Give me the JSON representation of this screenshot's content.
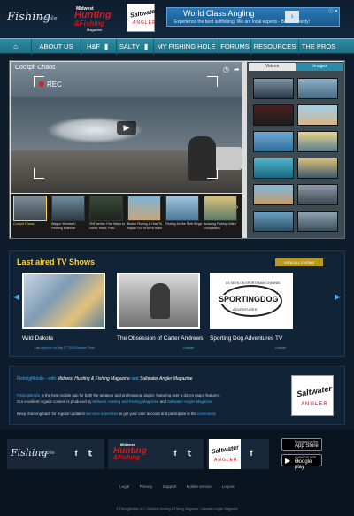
{
  "header": {
    "logo_fishingmobile": {
      "part1": "Fishing",
      "part2": "mobile"
    },
    "logo_mhf": {
      "line1": "Midwest",
      "line2": "Hunting",
      "line3": "&Fishing",
      "line4": "Magazine"
    },
    "logo_swa": {
      "line1": "Saltwater",
      "line2": "ANGLER"
    },
    "ad": {
      "title": "World Class Angling",
      "subtitle": "Experience the best saltfishing. We are local experts - Book Honesty!",
      "arrow": "›",
      "close": "ⓘ ✕"
    }
  },
  "nav": {
    "items": [
      {
        "label": "",
        "icon": "home-icon"
      },
      {
        "label": "ABOUT US"
      },
      {
        "label": "H&F",
        "icon": "bookmark-icon"
      },
      {
        "label": "SALTY",
        "icon": "bookmark-icon"
      },
      {
        "label": "MY FISHING HOLE"
      },
      {
        "label": "FORUMS"
      },
      {
        "label": "RESOURCES"
      },
      {
        "label": "THE PROS"
      }
    ]
  },
  "hero": {
    "video_title": "Cockpit Chaos",
    "rec_label": "REC",
    "tabs": {
      "videos": "Videos",
      "images": "Images"
    },
    "videos": [
      {
        "caption": "Cockpit Chaos",
        "selected": true
      },
      {
        "caption": "Wagon Wrecked ! Pitching bullreds!"
      },
      {
        "caption": "2NF series: Five Ways to check Yotes: Fish…"
      },
      {
        "caption": "Beach Fishing & How To Kayak Out SHARK Baits"
      },
      {
        "caption": "Fishing for the Reel Kings"
      },
      {
        "caption": "Amazing Fishing Video Compilation"
      }
    ]
  },
  "last_aired": {
    "title": "Last aired TV Shows",
    "view_all": "VIEW ALL SHOWS",
    "shows": [
      {
        "name": "Wild Dakota",
        "meta": "Last episode on May 27 2015 Eastern Time",
        "status": "Unaired"
      },
      {
        "name": "The Obsession of Carter Andrews",
        "meta": "",
        "status": "Unaired"
      },
      {
        "name": "Sporting Dog Adventures TV",
        "meta": "",
        "status": "Unaired"
      }
    ],
    "sporting_dog": {
      "top": "AS SEEN ON SPORTSMAN CHANNEL",
      "main": "SPORTINGDOG",
      "sub": "ADVENTURES"
    }
  },
  "about": {
    "title_a": "FishingMobile - with",
    "title_b": "Midwest Hunting & Fishing Magazine",
    "title_c": "and",
    "title_d": "Saltwater Angler Magazine",
    "line1_a": "FishingMobile",
    "line1_b": "is the best mobile app for both the amateur and professional angler, featuring over a dozen major features.",
    "line2_a": "Our excellent regular content is produced by",
    "line2_b": "Midwest Hunting and Fishing Magazine",
    "line2_c": "and",
    "line2_d": "Saltwater Angler Magazine",
    "line3_a": "Keep checking back for regular updates!",
    "line3_b": "Become a member",
    "line3_c": "to get your user account and participate in the",
    "line3_d": "community"
  },
  "footer": {
    "appstore": {
      "small": "Download on the",
      "big": "App Store"
    },
    "googleplay": {
      "small": "ANDROID APP ON",
      "big": "Google play"
    },
    "links": [
      "Legal",
      "Privacy",
      "Support",
      "Mobile version",
      "Logout"
    ],
    "copyright": "© FishingMobile LLC / Midwest Hunting & Fishing Magazine / Saltwater Angler Magazine"
  },
  "colors": {
    "accent": "#ffd23b",
    "nav": "#2d8ea5",
    "link": "#4aa6e0",
    "bg": "#0d1b2a"
  }
}
